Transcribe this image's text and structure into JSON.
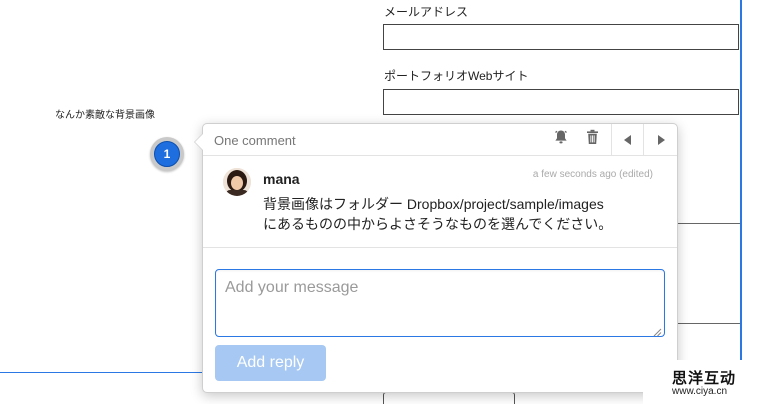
{
  "form": {
    "email_label": "メールアドレス",
    "email_value": "",
    "portfolio_label": "ポートフォリオWebサイト",
    "portfolio_value": "",
    "background_caption": "なんか素敵な背景画像"
  },
  "pin": {
    "number": "1",
    "color": "#1e6ee0"
  },
  "comment_popover": {
    "title": "One comment",
    "header_icons": [
      "bell-icon",
      "trash-icon",
      "prev-arrow-icon",
      "next-arrow-icon"
    ],
    "comments": [
      {
        "author": "mana",
        "timestamp": "a few seconds ago (edited)",
        "text_line1": "背景画像はフォルダー Dropbox/project/sample/images",
        "text_line2": "にあるものの中からよさそうなものを選んでください。"
      }
    ],
    "message_placeholder": "Add your message",
    "message_value": "",
    "reply_label": "Add reply",
    "reply_color": "#a6c8f2"
  },
  "watermark": {
    "chinese": "思洋互动",
    "url": "www.ciya.cn"
  },
  "colors": {
    "accent": "#2b78e4"
  }
}
